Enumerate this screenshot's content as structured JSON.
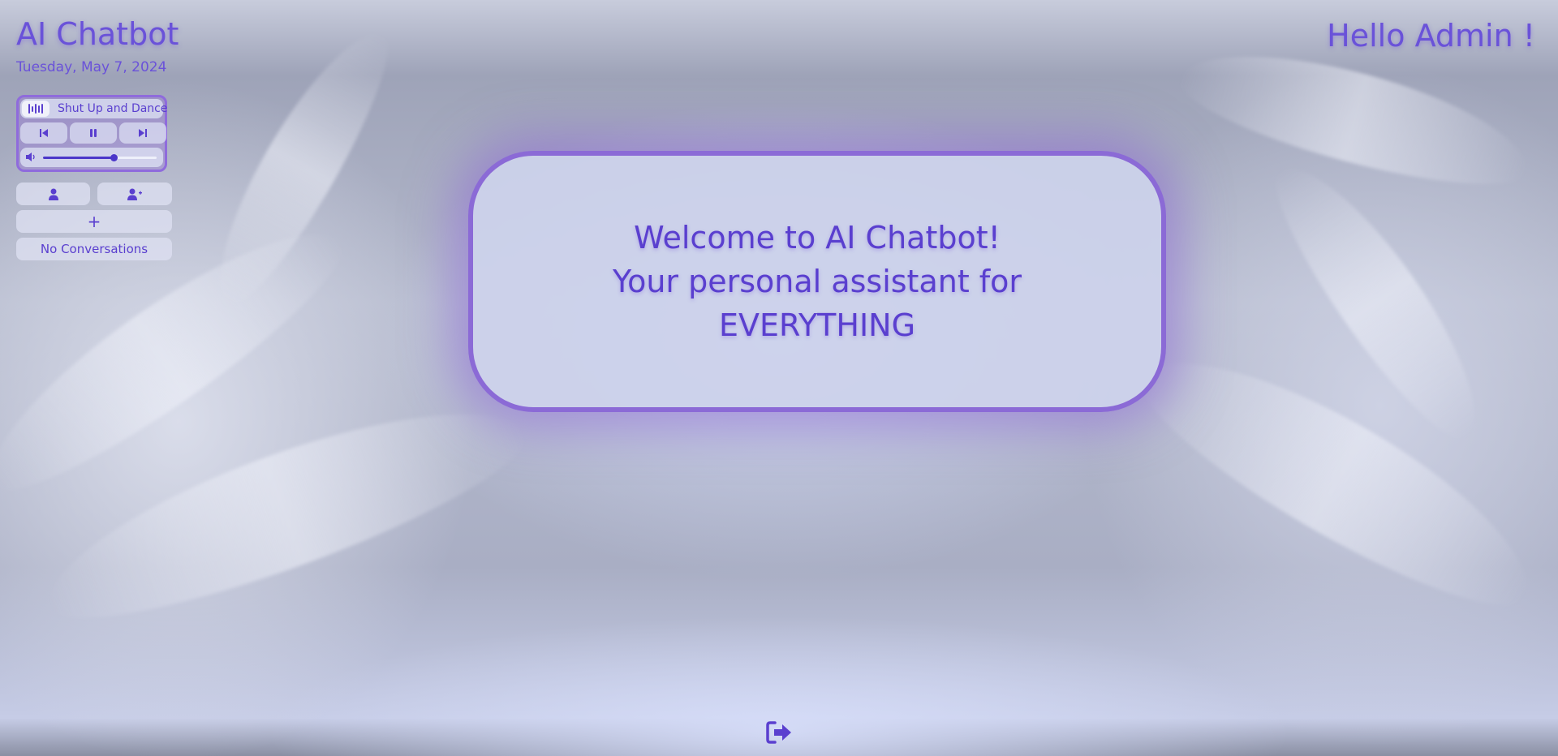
{
  "app": {
    "title": "AI Chatbot",
    "date": "Tuesday, May 7, 2024",
    "greeting": "Hello Admin !"
  },
  "player": {
    "track_name": "Shut Up and Dance",
    "volume": 0.62,
    "icons": {
      "track": "audio-wave-icon",
      "previous": "skip-previous-icon",
      "pause": "pause-icon",
      "next": "skip-next-icon",
      "volume": "volume-icon"
    }
  },
  "sidebar": {
    "profile_icon": "user-icon",
    "add_user_icon": "user-plus-icon",
    "new_chat_label": "+",
    "no_conversations": "No Conversations"
  },
  "welcome": {
    "line1": "Welcome to AI Chatbot!",
    "line2": "Your personal assistant for",
    "line3": "EVERYTHING"
  },
  "footer": {
    "logout_icon": "logout-icon"
  },
  "colors": {
    "accent": "#5a3fcf",
    "card_border": "#8b6ad6",
    "glow": "#8c64d7"
  }
}
